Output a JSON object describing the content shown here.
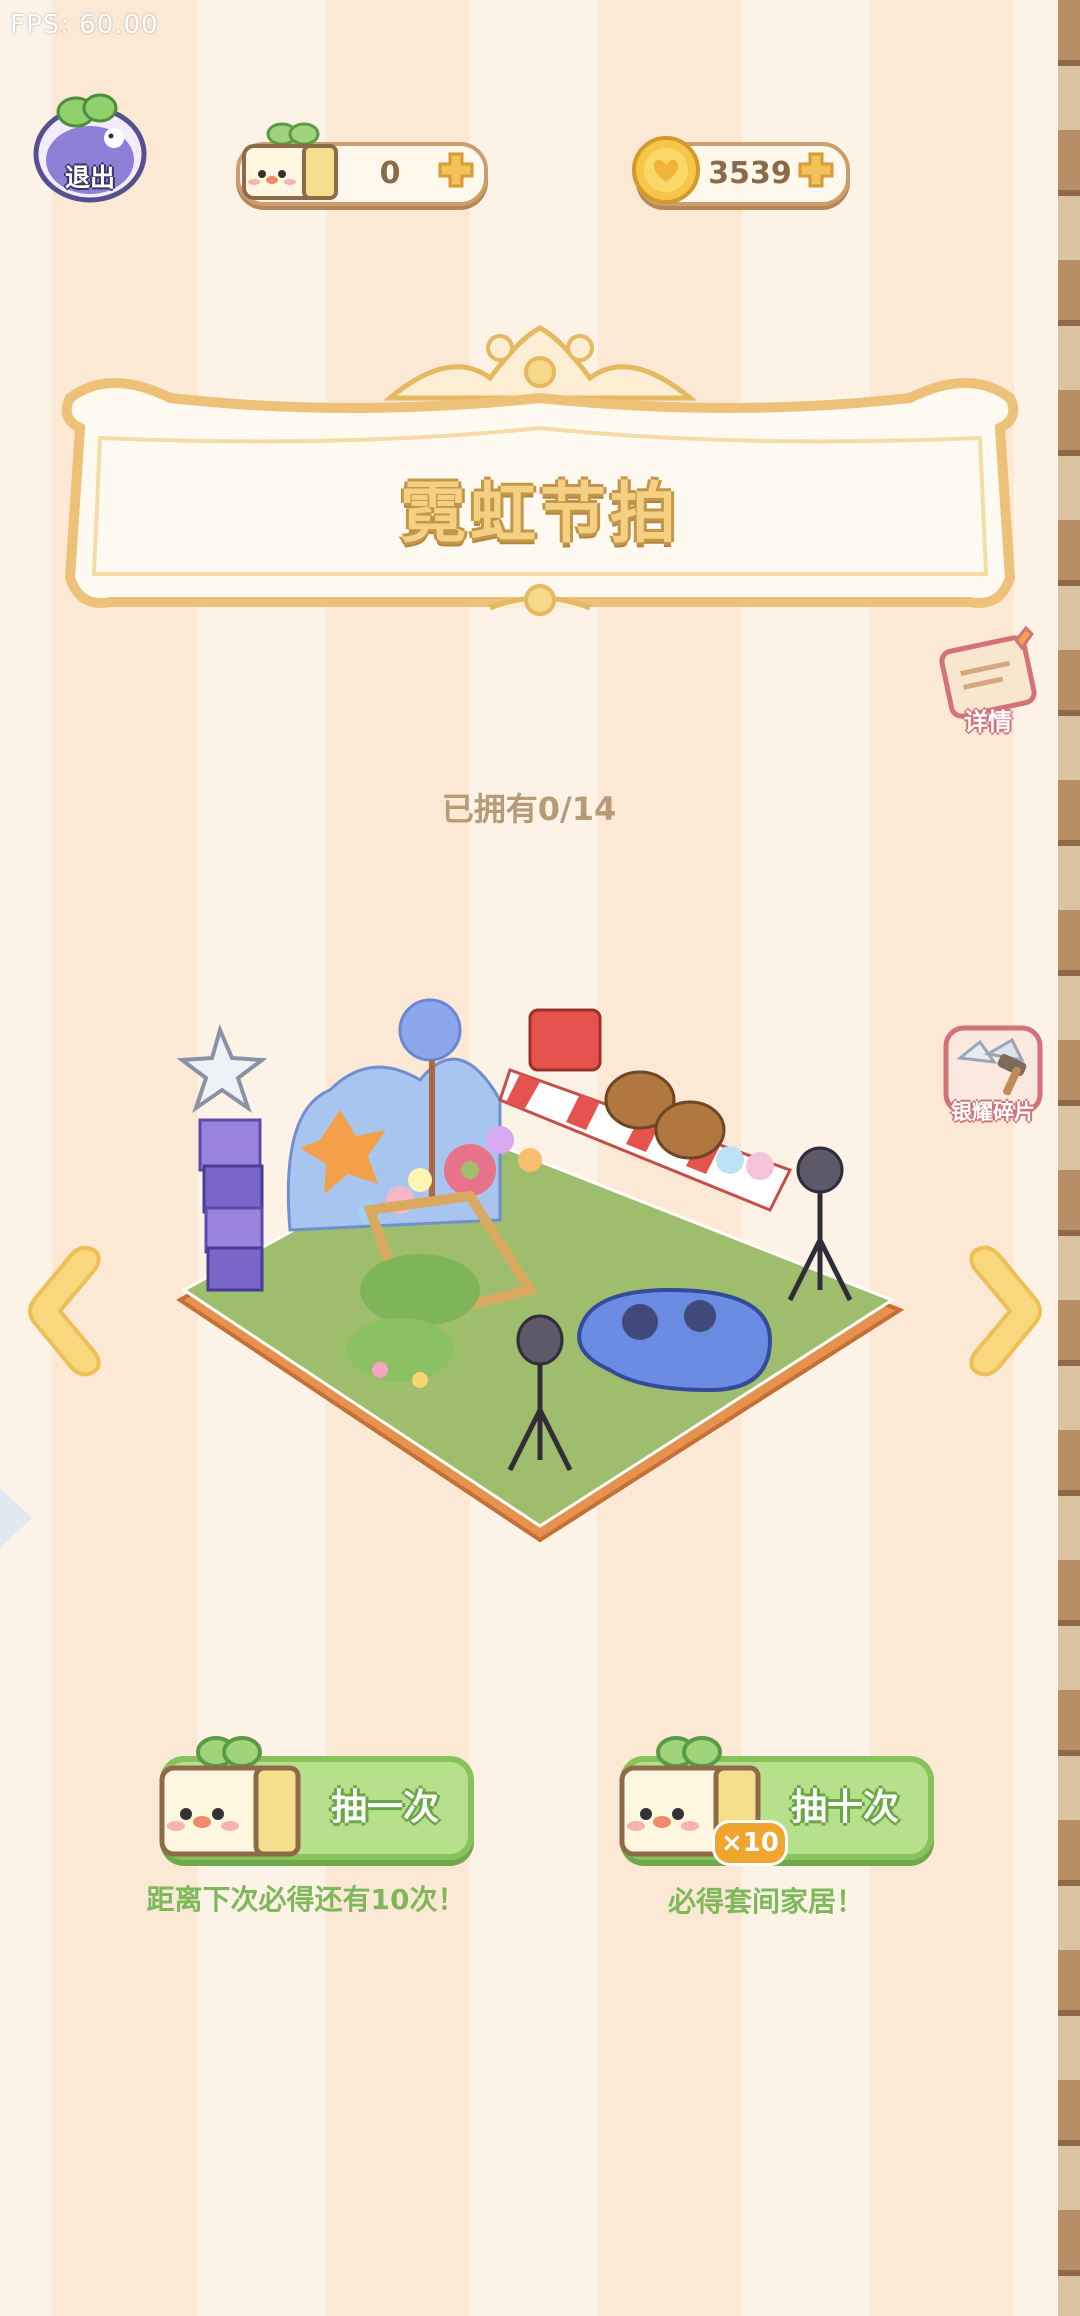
{
  "debug": {
    "fps": "FPS: 60.00"
  },
  "top_bar": {
    "exit_label": "退出",
    "sprout_tickets": "0",
    "coins": "3539"
  },
  "banner": {
    "title": "霓虹节拍"
  },
  "side_buttons": {
    "details_label": "详情",
    "shards_label": "银耀碎片"
  },
  "collection": {
    "owned": "已拥有0/14"
  },
  "draw": {
    "single_label": "抽一次",
    "single_note": "距离下次必得还有10次！",
    "ten_label": "抽十次",
    "ten_badge": "×10",
    "ten_note": "必得套间家居！"
  },
  "colors": {
    "stripe_light": "#fcf3e6",
    "stripe_dark": "#fbe9d5",
    "button_green": "#b7e08c",
    "title_gold": "#f4d082",
    "arrow_yellow": "#f8d77d"
  }
}
